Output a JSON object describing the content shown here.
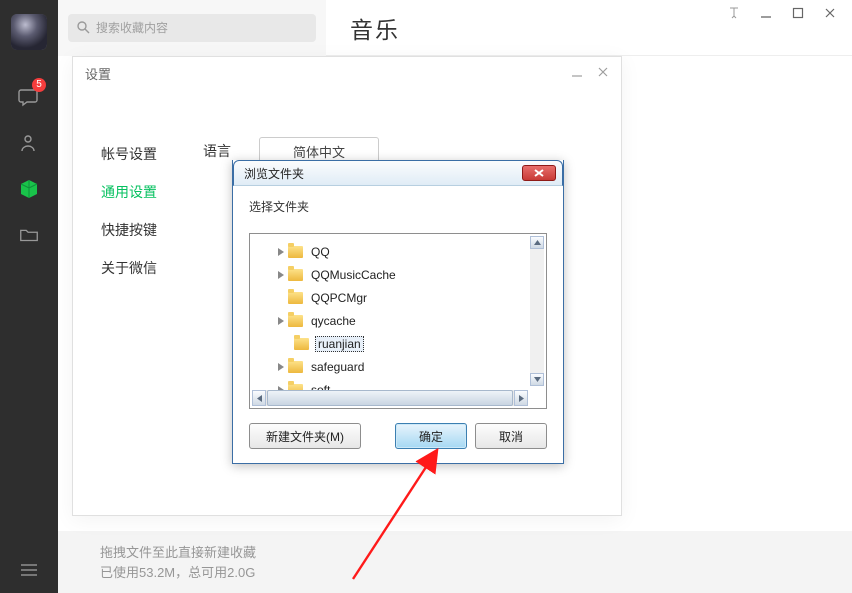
{
  "window": {
    "title": "音乐"
  },
  "search": {
    "placeholder": "搜索收藏内容"
  },
  "sidebar": {
    "messages_badge": "5"
  },
  "settings": {
    "title": "设置",
    "nav": {
      "account": "帐号设置",
      "general": "通用设置",
      "shortcuts": "快捷按键",
      "about": "关于微信"
    },
    "field_language_label": "语言",
    "field_language_value": "简体中文"
  },
  "browse": {
    "title": "浏览文件夹",
    "prompt": "选择文件夹",
    "items": [
      {
        "name": "QQ",
        "expandable": true
      },
      {
        "name": "QQMusicCache",
        "expandable": true
      },
      {
        "name": "QQPCMgr",
        "expandable": false
      },
      {
        "name": "qycache",
        "expandable": true
      },
      {
        "name": "ruanjian",
        "expandable": false,
        "selected": true
      },
      {
        "name": "safeguard",
        "expandable": true
      },
      {
        "name": "soft",
        "expandable": true
      }
    ],
    "btn_new_folder": "新建文件夹(M)",
    "btn_ok": "确定",
    "btn_cancel": "取消"
  },
  "footer": {
    "line1": "拖拽文件至此直接新建收藏",
    "line2": "已使用53.2M，总可用2.0G"
  }
}
